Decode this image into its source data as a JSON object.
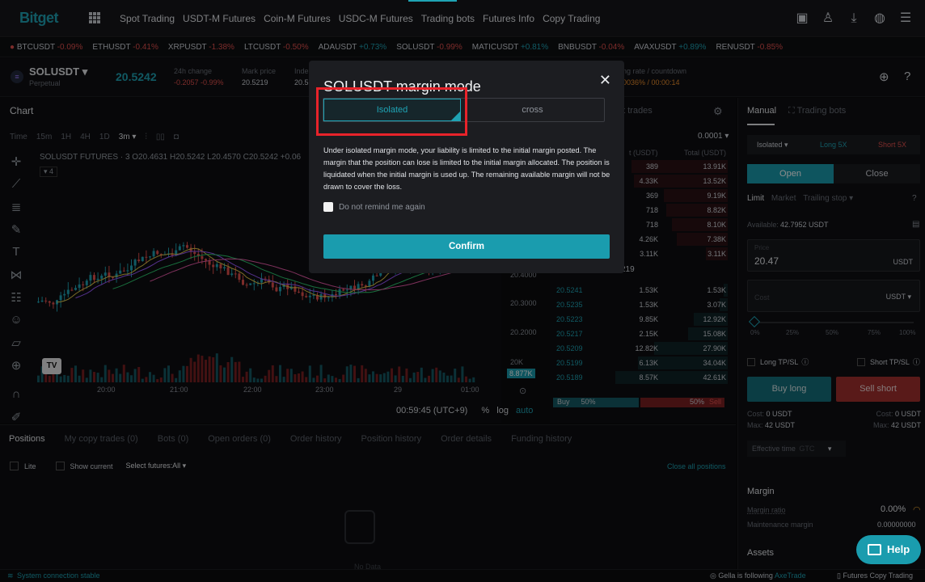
{
  "nav": {
    "logo": "Bitget",
    "links": [
      "Spot Trading",
      "USDT-M Futures",
      "Coin-M Futures",
      "USDC-M Futures",
      "Trading bots",
      "Futures Info",
      "Copy Trading"
    ]
  },
  "ticker": [
    {
      "sym": "BTCUSDT",
      "chg": "-0.09%",
      "dir": "red"
    },
    {
      "sym": "ETHUSDT",
      "chg": "-0.41%",
      "dir": "red"
    },
    {
      "sym": "XRPUSDT",
      "chg": "-1.38%",
      "dir": "red"
    },
    {
      "sym": "LTCUSDT",
      "chg": "-0.50%",
      "dir": "red"
    },
    {
      "sym": "ADAUSDT",
      "chg": "+0.73%",
      "dir": "green"
    },
    {
      "sym": "SOLUSDT",
      "chg": "-0.99%",
      "dir": "red"
    },
    {
      "sym": "MATICUSDT",
      "chg": "+0.81%",
      "dir": "green"
    },
    {
      "sym": "BNBUSDT",
      "chg": "-0.04%",
      "dir": "red"
    },
    {
      "sym": "AVAXUSDT",
      "chg": "+0.89%",
      "dir": "green"
    },
    {
      "sym": "RENUSDT",
      "chg": "-0.85%",
      "dir": "red"
    }
  ],
  "header": {
    "symbol": "SOLUSDT",
    "sub": "Perpetual",
    "last_price": "20.5242",
    "change_label": "24h change",
    "change_value": "-0.2057 -0.99%",
    "mark_label": "Mark price",
    "mark_value": "20.5219",
    "index_label": "Inde",
    "index_value": "20.5",
    "funding_label": "ng rate / countdown",
    "funding_value": "0036% / 00:00:14"
  },
  "chart": {
    "title": "Chart",
    "intervals": [
      "Time",
      "15m",
      "1H",
      "4H",
      "1D",
      "3m ▾"
    ],
    "legend": "SOLUSDT FUTURES · 3   O20.4631 H20.5242 L20.4570 C20.5242 +0.06",
    "indicator_count": "4",
    "time_labels": [
      "20:00",
      "21:00",
      "22:00",
      "23:00",
      "29",
      "01:00"
    ],
    "price_labels": [
      "20.4000",
      "20.3000",
      "20.2000"
    ],
    "volume_label": "20K",
    "volume_badge": "8.877K",
    "footer_time": "00:59:45 (UTC+9)",
    "footer_pct": "%",
    "footer_log": "log",
    "footer_auto": "auto"
  },
  "orderbook": {
    "tab": "et trades",
    "precision": "0.0001",
    "col_qty": "t (USDT)",
    "col_total": "Total (USDT)",
    "asks": [
      {
        "qty": "389",
        "total": "13.91K"
      },
      {
        "qty": "4.33K",
        "total": "13.52K"
      },
      {
        "qty": "369",
        "total": "9.19K"
      },
      {
        "qty": "718",
        "total": "8.82K"
      },
      {
        "qty": "718",
        "total": "8.10K"
      },
      {
        "qty": "4.26K",
        "total": "7.38K"
      },
      {
        "qty": "3.11K",
        "total": "3.11K"
      }
    ],
    "mid": "219",
    "bids": [
      {
        "price": "20.5241",
        "qty": "1.53K",
        "total": "1.53K"
      },
      {
        "price": "20.5235",
        "qty": "1.53K",
        "total": "3.07K"
      },
      {
        "price": "20.5223",
        "qty": "9.85K",
        "total": "12.92K"
      },
      {
        "price": "20.5217",
        "qty": "2.15K",
        "total": "15.08K"
      },
      {
        "price": "20.5209",
        "qty": "12.82K",
        "total": "27.90K"
      },
      {
        "price": "20.5199",
        "qty": "6.13K",
        "total": "34.04K"
      },
      {
        "price": "20.5189",
        "qty": "8.57K",
        "total": "42.61K"
      }
    ],
    "buy_label": "Buy",
    "buy_pct": "50%",
    "sell_pct": "50%",
    "sell_label": "Sell"
  },
  "bottom": {
    "tabs": [
      "Positions",
      "My copy trades (0)",
      "Bots (0)",
      "Open orders (0)",
      "Order history",
      "Position history",
      "Order details",
      "Funding history"
    ],
    "lite": "Lite",
    "show_current": "Show current",
    "select_futures": "Select futures:All",
    "close_all": "Close all positions",
    "no_data": "No Data"
  },
  "trade": {
    "tab_manual": "Manual",
    "tab_bots": "Trading bots",
    "margin_mode": "Isolated",
    "long_lev": "Long 5X",
    "short_lev": "Short 5X",
    "open": "Open",
    "close": "Close",
    "order_types": [
      "Limit",
      "Market",
      "Trailing stop"
    ],
    "available_label": "Available:",
    "available_value": "42.7952 USDT",
    "price_label": "Price",
    "price_value": "20.47",
    "price_unit": "USDT",
    "cost_placeholder": "Cost",
    "cost_unit": "USDT",
    "slider_marks": [
      "0%",
      "25%",
      "50%",
      "75%",
      "100%"
    ],
    "long_tpsl": "Long TP/SL",
    "short_tpsl": "Short TP/SL",
    "buy_long": "Buy long",
    "sell_short": "Sell short",
    "cost_left": "Cost:",
    "cost_left_val": "0 USDT",
    "max_left": "Max:",
    "max_left_val": "42 USDT",
    "cost_right": "Cost:",
    "cost_right_val": "0 USDT",
    "max_right": "Max:",
    "max_right_val": "42 USDT",
    "effective_time": "Effective time",
    "effective_val": "GTC",
    "margin_title": "Margin",
    "margin_ratio": "Margin ratio",
    "margin_ratio_val": "0.00%",
    "maint_margin": "Maintenance margin",
    "maint_val": "0.00000000",
    "assets": "Assets"
  },
  "status": {
    "connection": "System connection stable",
    "follow_user": "Gella",
    "follow_text": "is following",
    "follow_target": "AxeTrade",
    "copy_trading": "Futures Copy Trading"
  },
  "modal": {
    "title": "SOLUSDT margin mode",
    "isolated": "Isolated",
    "cross": "cross",
    "description": "Under isolated margin mode, your liability is limited to the initial margin posted. The margin that the position can lose is limited to the initial margin allocated. The position is liquidated when the initial margin is used up. The remaining available margin will not be drawn to cover the loss.",
    "remind": "Do not remind me again",
    "confirm": "Confirm"
  },
  "help": "Help",
  "colors": {
    "accent": "#1fa3b4",
    "down": "#e2504d",
    "highlight": "#e8232a"
  }
}
